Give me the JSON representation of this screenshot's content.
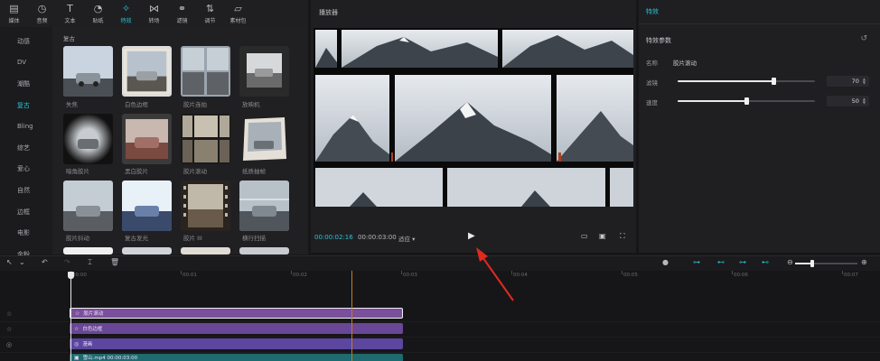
{
  "toolbar": {
    "items": [
      {
        "label": "媒体",
        "icon": "media-icon"
      },
      {
        "label": "音频",
        "icon": "audio-icon"
      },
      {
        "label": "文本",
        "icon": "text-icon"
      },
      {
        "label": "贴纸",
        "icon": "sticker-icon"
      },
      {
        "label": "特效",
        "icon": "effects-icon",
        "active": true
      },
      {
        "label": "转场",
        "icon": "transition-icon"
      },
      {
        "label": "滤镜",
        "icon": "filter-icon"
      },
      {
        "label": "调节",
        "icon": "adjust-icon"
      },
      {
        "label": "素材包",
        "icon": "package-icon"
      }
    ]
  },
  "categories": [
    "动感",
    "DV",
    "潮酷",
    "复古",
    "Bling",
    "综艺",
    "爱心",
    "自然",
    "边框",
    "电影",
    "金粉"
  ],
  "active_category": "复古",
  "effects": {
    "section_title": "复古",
    "items": [
      {
        "label": "失焦"
      },
      {
        "label": "白色边框"
      },
      {
        "label": "胶片连拍"
      },
      {
        "label": "放映机"
      },
      {
        "label": "暗角胶片"
      },
      {
        "label": "黑白胶片"
      },
      {
        "label": "胶片滚动"
      },
      {
        "label": "纸质抽帧"
      },
      {
        "label": "胶片抖动"
      },
      {
        "label": "复古发光"
      },
      {
        "label": "胶片 III"
      },
      {
        "label": "横行扫描"
      }
    ]
  },
  "player": {
    "title": "播放器",
    "time_current": "00:00:02:16",
    "time_total": "00:00:03:00",
    "ratio_label": "适应",
    "ratio_caret": "▾",
    "play_icon": "▶",
    "controls": [
      "▭",
      "▣",
      "⛶"
    ]
  },
  "properties": {
    "header": "特效",
    "section": "特效参数",
    "reset_icon": "↺",
    "name_label": "名称",
    "name_value": "胶片滚动",
    "params": [
      {
        "label": "滤镜",
        "value": 70
      },
      {
        "label": "速度",
        "value": 50
      }
    ],
    "param_max": 100
  },
  "timeline": {
    "tools": [
      "↖",
      "⌄",
      "↶",
      "↷",
      "⌶",
      "🗑"
    ],
    "ticks": [
      "00:00",
      "00:01",
      "00:02",
      "00:03",
      "00:04",
      "00:05",
      "00:06",
      "00:07"
    ],
    "zoom_value": 0.28,
    "clips": [
      {
        "label": "胶片滚动",
        "icon": "☆",
        "color": "#7b4f9c",
        "selected": true
      },
      {
        "label": "白色边框",
        "icon": "☆",
        "color": "#6a4796"
      },
      {
        "label": "漫画",
        "icon": "◎",
        "color": "#5c46a0"
      },
      {
        "label": "雪山.mp4  00:00:03:00",
        "icon": "▣",
        "color": "#1f6a6e"
      }
    ],
    "lane_icons": [
      "☆",
      "☆",
      "◎"
    ]
  },
  "colors": {
    "accent": "#27c4d4",
    "playhead": "#e8e8ea",
    "cursor": "#c87a1a",
    "arrow": "#e02a1f"
  }
}
